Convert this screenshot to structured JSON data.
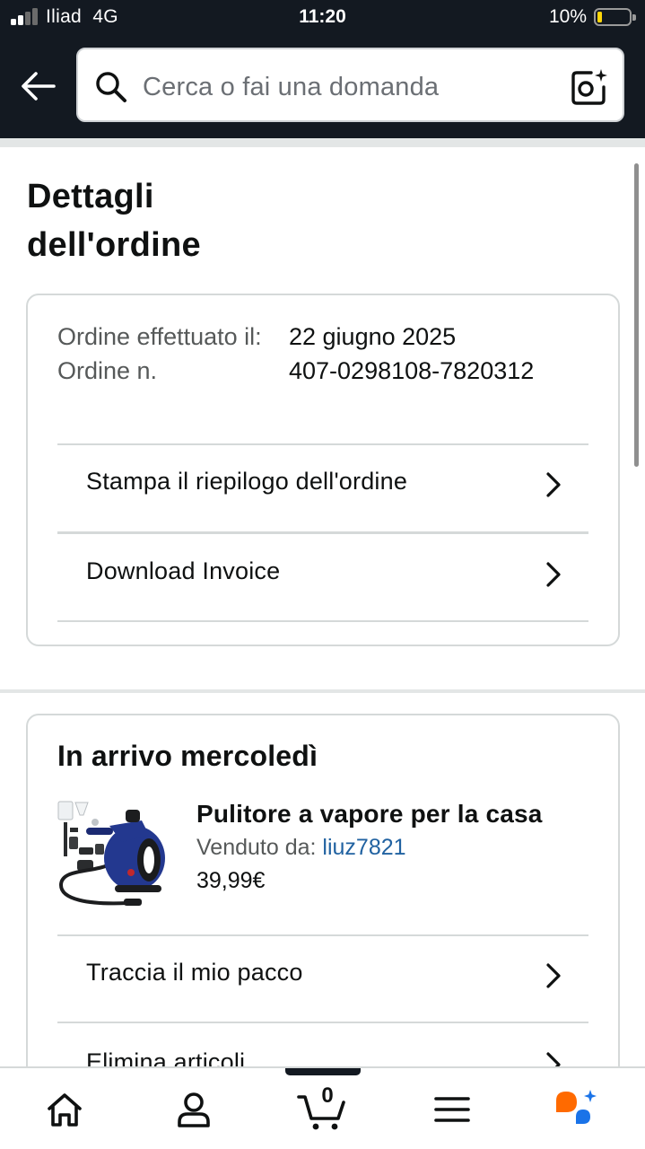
{
  "status_bar": {
    "carrier": "Iliad",
    "network": "4G",
    "time": "11:20",
    "battery_percent": "10%",
    "battery_level": 0.1,
    "signal_bars_active": 2
  },
  "header": {
    "search_placeholder": "Cerca o fai una domanda",
    "icons": [
      "back-arrow-icon",
      "search-icon",
      "camera-lens-icon"
    ]
  },
  "page": {
    "title": "Dettagli dell'ordine"
  },
  "order_summary": {
    "label_date": "Ordine effettuato il:",
    "label_number": "Ordine n.",
    "date": "22 giugno 2025",
    "number": "407-0298108-7820312",
    "actions": [
      {
        "label": "Stampa il riepilogo dell'ordine"
      },
      {
        "label": "Download Invoice"
      }
    ]
  },
  "shipment": {
    "arrival": "In arrivo mercoledì",
    "product": {
      "name": "Pulitore a vapore per la casa",
      "sold_by_label": "Venduto da:",
      "seller": "liuz7821",
      "price": "39,99€"
    },
    "actions": [
      {
        "label": "Traccia il mio pacco"
      },
      {
        "label": "Elimina articoli"
      }
    ]
  },
  "bottom_nav": {
    "cart_count": "0",
    "items": [
      "home-icon",
      "account-icon",
      "cart-icon",
      "menu-icon",
      "rufus-ai-icon"
    ]
  },
  "colors": {
    "header_bg": "#131921",
    "link": "#2162a1",
    "border": "#d5d9d9",
    "battery_low": "#ffd60a",
    "ai_orange": "#ff6a00",
    "ai_blue": "#1a73e8"
  }
}
